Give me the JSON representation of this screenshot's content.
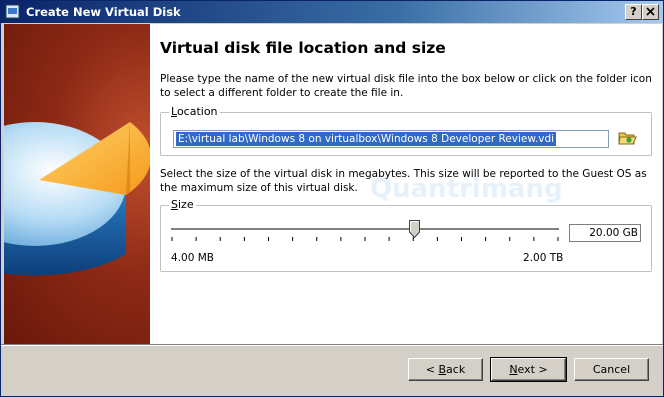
{
  "window": {
    "title": "Create New Virtual Disk",
    "help_label": "?",
    "close_label": "X"
  },
  "page": {
    "heading": "Virtual disk file location and size",
    "description": "Please type the name of the new virtual disk file into the box below or click on the folder icon to select a different folder to create the file in.",
    "location": {
      "label_accel": "L",
      "label_rest": "ocation",
      "path": "E:\\virtual lab\\Windows 8 on virtualbox\\Windows 8 Developer Review.vdi"
    },
    "size_description": "Select the size of the virtual disk in megabytes. This size will be reported to the Guest OS as the maximum size of this virtual disk.",
    "size": {
      "label_accel": "S",
      "label_rest": "ize",
      "value": "20.00 GB",
      "min_label": "4.00 MB",
      "max_label": "2.00 TB",
      "slider_fraction": 0.63
    }
  },
  "watermark": "Quantrimang",
  "buttons": {
    "back_prefix": "< ",
    "back_accel": "B",
    "back_rest": "ack",
    "next_accel": "N",
    "next_rest": "ext >",
    "cancel": "Cancel"
  },
  "colors": {
    "title_bar": "#0a246a",
    "selection": "#316ac5",
    "banner": "#8e2a16"
  }
}
